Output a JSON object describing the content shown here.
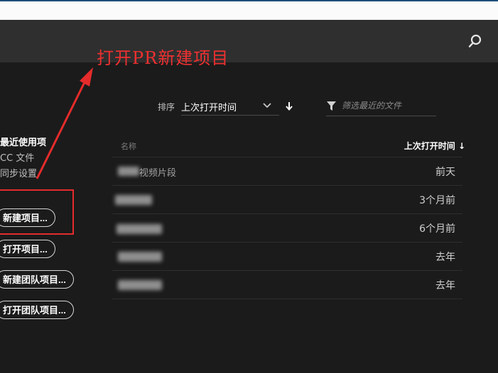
{
  "header": {
    "search_icon": "search-icon"
  },
  "annotation": {
    "text": "打开PR新建项目",
    "color": "#ee3030"
  },
  "sidebar": {
    "nav_items": [
      {
        "label": "最近使用项",
        "active": true
      },
      {
        "label": "CC 文件",
        "active": false
      },
      {
        "label": "同步设置",
        "active": false
      }
    ],
    "buttons": [
      {
        "label": "新建项目..."
      },
      {
        "label": "打开项目..."
      },
      {
        "label": "新建团队项目..."
      },
      {
        "label": "打开团队项目..."
      }
    ]
  },
  "toolbar": {
    "sort_label": "排序",
    "sort_value": "上次打开时间",
    "sort_direction_icon": "arrow-down-icon",
    "filter_icon": "funnel-icon",
    "filter_placeholder": "筛选最近的文件"
  },
  "table": {
    "columns": [
      "名称",
      "上次打开时间"
    ],
    "sort_arrow": "↓",
    "rows": [
      {
        "name": "视频片段",
        "date": "前天"
      },
      {
        "name": "",
        "date": "3个月前"
      },
      {
        "name": "",
        "date": "6个月前"
      },
      {
        "name": "",
        "date": "去年"
      },
      {
        "name": "",
        "date": "去年"
      }
    ]
  }
}
